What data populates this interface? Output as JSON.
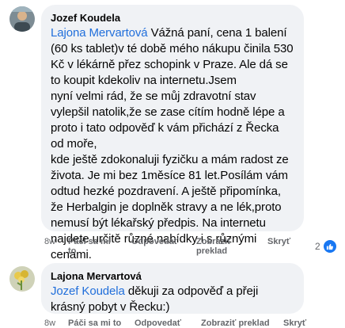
{
  "comments": [
    {
      "author": "Jozef Koudela",
      "mention": "Lajona Mervartová",
      "text": " Vážná paní, cena 1 balení (60 ks tablet)v té době mého nákupu činila 530 Kč v lékárně přez schopink v Praze. Ale dá se to koupit kdekoliv na internetu.Jsem\nnyní velmi rád, že se můj zdravotní stav vylepšil natolik,že se zase cítím hodně lépe a proto i tato odpověď k vám přichází z Řecka od moře,\nkde ještě zdokonaluji fyzičku a mám radost ze života. Je mi bez 1měsíce 81 let.Posílám vám odtud hezké pozdravení. A ještě připomínka, že Herbalgin je doplněk stravy a ne lék,proto nemusí být lékařský předpis. Na internetu najdete určitě různé nabídky i s různými cenami.",
      "actions": {
        "time": "8w",
        "like_line1": "Páči sa mi",
        "like_line2": "to",
        "reply": "Odpovedať",
        "translate_line1": "Zobraziť",
        "translate_line2": "preklad",
        "hide": "Skryť"
      },
      "reaction_count": "2",
      "reaction_icon": "like-icon"
    },
    {
      "author": "Lajona Mervartová",
      "mention": "Jozef Koudela",
      "text": " děkuji za odpověď a přeji krásný pobyt v Řecku:)",
      "actions": {
        "time": "8w",
        "like": "Páči sa mi to",
        "reply": "Odpovedať",
        "translate": "Zobraziť preklad",
        "hide": "Skryť"
      }
    }
  ],
  "colors": {
    "bubble": "#f0f2f5",
    "mention": "#216fdb",
    "meta": "#65676b",
    "like": "#1877f2"
  }
}
